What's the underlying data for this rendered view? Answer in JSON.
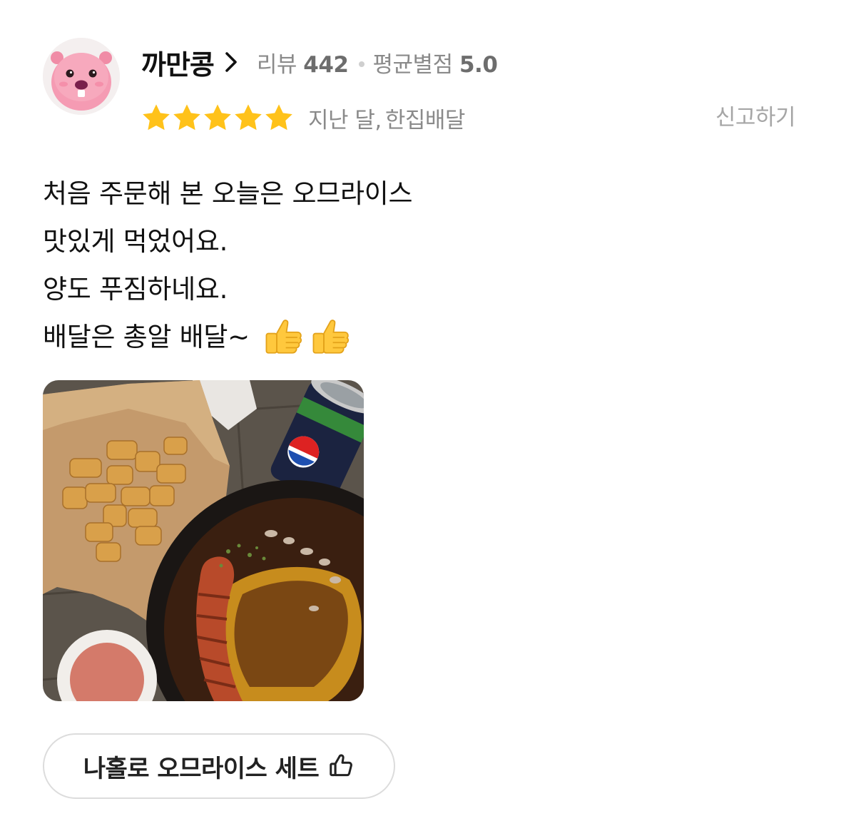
{
  "reviewer": {
    "nickname": "까만콩",
    "review_label": "리뷰",
    "review_count": "442",
    "avg_label": "평균별점",
    "avg_rating": "5.0",
    "avatar_icon": "beaver-avatar-icon"
  },
  "review": {
    "rating": 5,
    "date": "지난 달,",
    "store": "한집배달",
    "report_label": "신고하기",
    "lines": [
      "처음 주문해 본 오늘은 오므라이스",
      "맛있게 먹었어요.",
      "양도 푸짐하네요.",
      "배달은 총알 배달~"
    ],
    "emoji": [
      "thumbs-up-emoji",
      "thumbs-up-emoji"
    ],
    "photo": "food-photo-omurice-tater-tots-cola"
  },
  "menu_chip": {
    "label": "나홀로 오므라이스 세트",
    "icon": "thumbs-up-outline-icon"
  },
  "colors": {
    "star": "#FFC21A",
    "muted_text": "#8A8A8A",
    "report_text": "#A6A6A6",
    "chip_border": "#DCDCDC"
  }
}
